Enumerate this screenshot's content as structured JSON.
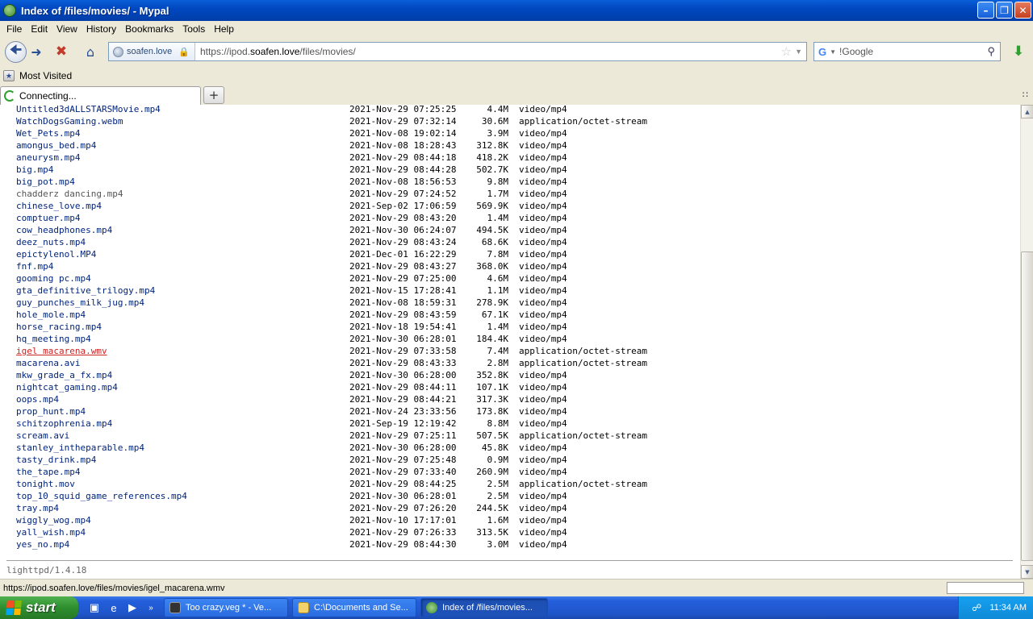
{
  "window": {
    "title": "Index of /files/movies/ - Mypal"
  },
  "menu": [
    "File",
    "Edit",
    "View",
    "History",
    "Bookmarks",
    "Tools",
    "Help"
  ],
  "nav": {
    "identity": "soafen.love",
    "url_prefix": "https://ipod.",
    "url_domain": "soafen.love",
    "url_path": "/files/movies/",
    "search_placeholder": "!Google",
    "search_engine_icon": "G"
  },
  "bookmarks": {
    "most_visited": "Most Visited"
  },
  "tabs": [
    {
      "label": "Connecting..."
    }
  ],
  "listing": {
    "rows": [
      {
        "name": "Untitled3dALLSTARSMovie.mp4",
        "date": "2021-Nov-29 07:25:25",
        "size": "4.4M",
        "type": "video/mp4",
        "state": ""
      },
      {
        "name": "WatchDogsGaming.webm",
        "date": "2021-Nov-29 07:32:14",
        "size": "30.6M",
        "type": "application/octet-stream",
        "state": ""
      },
      {
        "name": "Wet_Pets.mp4",
        "date": "2021-Nov-08 19:02:14",
        "size": "3.9M",
        "type": "video/mp4",
        "state": ""
      },
      {
        "name": "amongus_bed.mp4",
        "date": "2021-Nov-08 18:28:43",
        "size": "312.8K",
        "type": "video/mp4",
        "state": ""
      },
      {
        "name": "aneurysm.mp4",
        "date": "2021-Nov-29 08:44:18",
        "size": "418.2K",
        "type": "video/mp4",
        "state": ""
      },
      {
        "name": "big.mp4",
        "date": "2021-Nov-29 08:44:28",
        "size": "502.7K",
        "type": "video/mp4",
        "state": ""
      },
      {
        "name": "big_pot.mp4",
        "date": "2021-Nov-08 18:56:53",
        "size": "9.8M",
        "type": "video/mp4",
        "state": ""
      },
      {
        "name": "chadderz dancing.mp4",
        "date": "2021-Nov-29 07:24:52",
        "size": "1.7M",
        "type": "video/mp4",
        "state": "visited"
      },
      {
        "name": "chinese_love.mp4",
        "date": "2021-Sep-02 17:06:59",
        "size": "569.9K",
        "type": "video/mp4",
        "state": ""
      },
      {
        "name": "comptuer.mp4",
        "date": "2021-Nov-29 08:43:20",
        "size": "1.4M",
        "type": "video/mp4",
        "state": ""
      },
      {
        "name": "cow_headphones.mp4",
        "date": "2021-Nov-30 06:24:07",
        "size": "494.5K",
        "type": "video/mp4",
        "state": ""
      },
      {
        "name": "deez_nuts.mp4",
        "date": "2021-Nov-29 08:43:24",
        "size": "68.6K",
        "type": "video/mp4",
        "state": ""
      },
      {
        "name": "epictylenol.MP4",
        "date": "2021-Dec-01 16:22:29",
        "size": "7.8M",
        "type": "video/mp4",
        "state": ""
      },
      {
        "name": "fnf.mp4",
        "date": "2021-Nov-29 08:43:27",
        "size": "368.0K",
        "type": "video/mp4",
        "state": ""
      },
      {
        "name": "gooming pc.mp4",
        "date": "2021-Nov-29 07:25:00",
        "size": "4.6M",
        "type": "video/mp4",
        "state": ""
      },
      {
        "name": "gta_definitive_trilogy.mp4",
        "date": "2021-Nov-15 17:28:41",
        "size": "1.1M",
        "type": "video/mp4",
        "state": ""
      },
      {
        "name": "guy_punches_milk_jug.mp4",
        "date": "2021-Nov-08 18:59:31",
        "size": "278.9K",
        "type": "video/mp4",
        "state": ""
      },
      {
        "name": "hole_mole.mp4",
        "date": "2021-Nov-29 08:43:59",
        "size": "67.1K",
        "type": "video/mp4",
        "state": ""
      },
      {
        "name": "horse_racing.mp4",
        "date": "2021-Nov-18 19:54:41",
        "size": "1.4M",
        "type": "video/mp4",
        "state": ""
      },
      {
        "name": "hq_meeting.mp4",
        "date": "2021-Nov-30 06:28:01",
        "size": "184.4K",
        "type": "video/mp4",
        "state": ""
      },
      {
        "name": "igel macarena.wmv",
        "date": "2021-Nov-29 07:33:58",
        "size": "7.4M",
        "type": "application/octet-stream",
        "state": "hover"
      },
      {
        "name": "macarena.avi",
        "date": "2021-Nov-29 08:43:33",
        "size": "2.8M",
        "type": "application/octet-stream",
        "state": ""
      },
      {
        "name": "mkw_grade_a_fx.mp4",
        "date": "2021-Nov-30 06:28:00",
        "size": "352.8K",
        "type": "video/mp4",
        "state": ""
      },
      {
        "name": "nightcat_gaming.mp4",
        "date": "2021-Nov-29 08:44:11",
        "size": "107.1K",
        "type": "video/mp4",
        "state": ""
      },
      {
        "name": "oops.mp4",
        "date": "2021-Nov-29 08:44:21",
        "size": "317.3K",
        "type": "video/mp4",
        "state": ""
      },
      {
        "name": "prop_hunt.mp4",
        "date": "2021-Nov-24 23:33:56",
        "size": "173.8K",
        "type": "video/mp4",
        "state": ""
      },
      {
        "name": "schitzophrenia.mp4",
        "date": "2021-Sep-19 12:19:42",
        "size": "8.8M",
        "type": "video/mp4",
        "state": ""
      },
      {
        "name": "scream.avi",
        "date": "2021-Nov-29 07:25:11",
        "size": "507.5K",
        "type": "application/octet-stream",
        "state": ""
      },
      {
        "name": "stanley_intheparable.mp4",
        "date": "2021-Nov-30 06:28:00",
        "size": "45.8K",
        "type": "video/mp4",
        "state": ""
      },
      {
        "name": "tasty_drink.mp4",
        "date": "2021-Nov-29 07:25:48",
        "size": "0.9M",
        "type": "video/mp4",
        "state": ""
      },
      {
        "name": "the_tape.mp4",
        "date": "2021-Nov-29 07:33:40",
        "size": "260.9M",
        "type": "video/mp4",
        "state": ""
      },
      {
        "name": "tonight.mov",
        "date": "2021-Nov-29 08:44:25",
        "size": "2.5M",
        "type": "application/octet-stream",
        "state": ""
      },
      {
        "name": "top_10_squid_game_references.mp4",
        "date": "2021-Nov-30 06:28:01",
        "size": "2.5M",
        "type": "video/mp4",
        "state": ""
      },
      {
        "name": "tray.mp4",
        "date": "2021-Nov-29 07:26:20",
        "size": "244.5K",
        "type": "video/mp4",
        "state": ""
      },
      {
        "name": "wiggly_wog.mp4",
        "date": "2021-Nov-10 17:17:01",
        "size": "1.6M",
        "type": "video/mp4",
        "state": ""
      },
      {
        "name": "yall_wish.mp4",
        "date": "2021-Nov-29 07:26:33",
        "size": "313.5K",
        "type": "video/mp4",
        "state": ""
      },
      {
        "name": "yes_no.mp4",
        "date": "2021-Nov-29 08:44:30",
        "size": "3.0M",
        "type": "video/mp4",
        "state": ""
      }
    ],
    "footer": "lighttpd/1.4.18"
  },
  "status": {
    "text": "https://ipod.soafen.love/files/movies/igel_macarena.wmv"
  },
  "taskbar": {
    "start_label": "start",
    "tasks": [
      {
        "label": "Too crazy.veg * - Ve...",
        "active": false
      },
      {
        "label": "C:\\Documents and Se...",
        "active": false
      },
      {
        "label": "Index of /files/movies...",
        "active": true
      }
    ],
    "clock": "11:34 AM"
  },
  "colors": {
    "link": "#00247d",
    "visited": "#555555",
    "hover_link": "#cc2222"
  }
}
